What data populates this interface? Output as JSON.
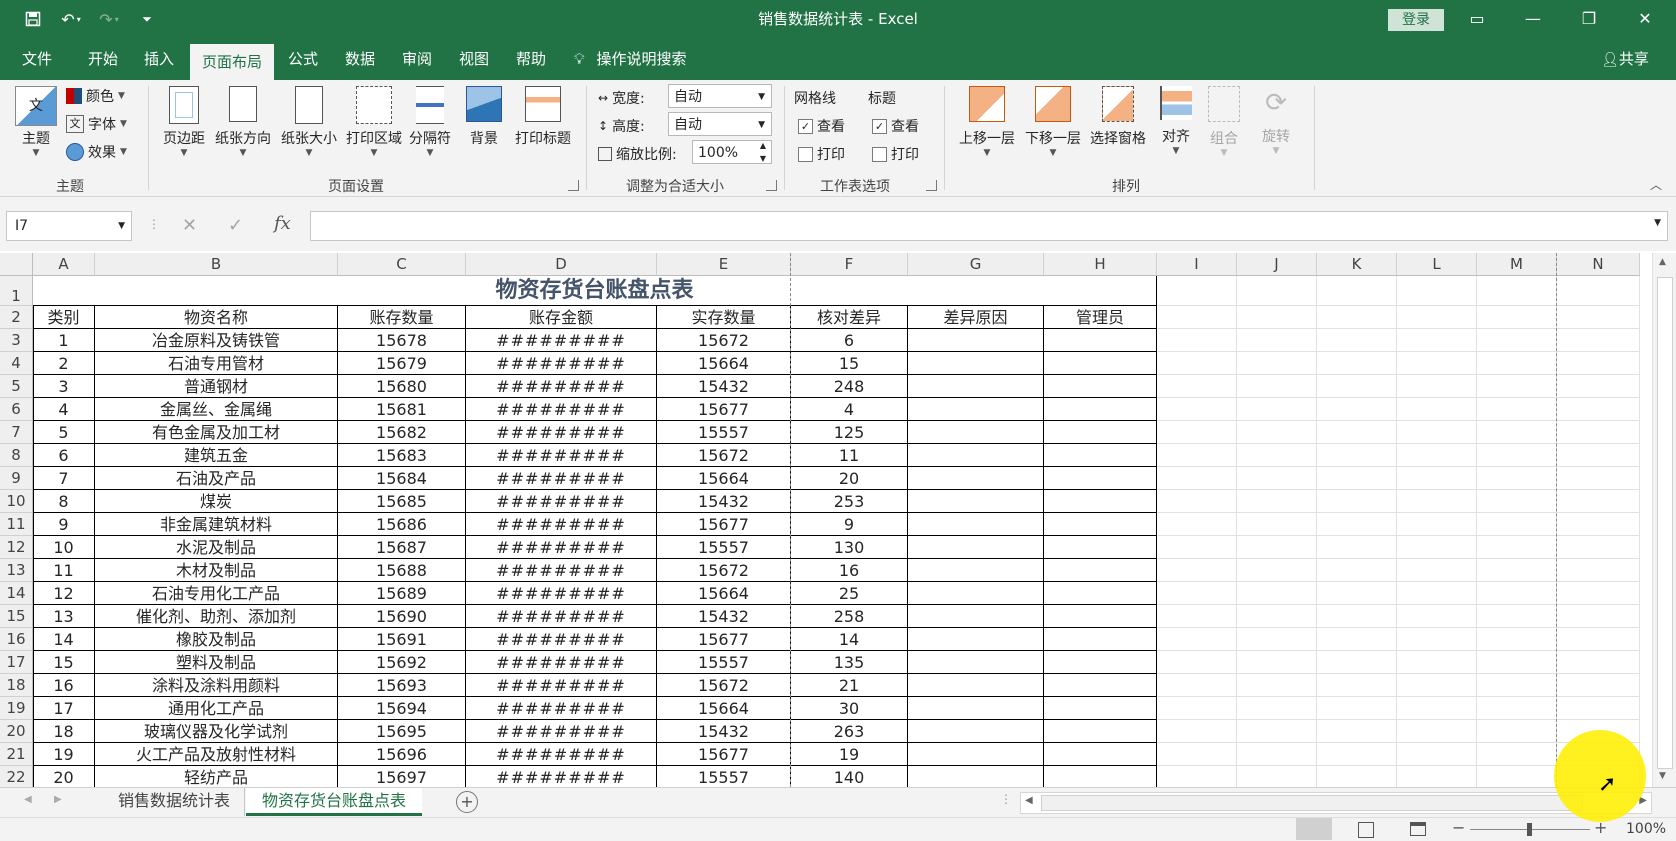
{
  "window": {
    "title": "销售数据统计表 - Excel",
    "login_label": "登录",
    "share_label": "共享"
  },
  "ribbon_tabs": [
    "文件",
    "开始",
    "插入",
    "页面布局",
    "公式",
    "数据",
    "审阅",
    "视图",
    "帮助",
    "操作说明搜索"
  ],
  "ribbon": {
    "theme": {
      "theme_btn": "主题",
      "colors": "颜色",
      "fonts": "字体",
      "effects": "效果",
      "group_label": "主题"
    },
    "page_setup": {
      "margins": "页边距",
      "orientation": "纸张方向",
      "size": "纸张大小",
      "print_area": "打印区域",
      "breaks": "分隔符",
      "background": "背景",
      "print_titles": "打印标题",
      "group_label": "页面设置"
    },
    "scale_to_fit": {
      "width_label": "宽度:",
      "width_value": "自动",
      "height_label": "高度:",
      "height_value": "自动",
      "scale_label": "缩放比例:",
      "scale_value": "100%",
      "group_label": "调整为合适大小"
    },
    "sheet_options": {
      "gridlines": "网格线",
      "headings": "标题",
      "view": "查看",
      "print": "打印",
      "group_label": "工作表选项"
    },
    "arrange": {
      "bring_forward": "上移一层",
      "send_backward": "下移一层",
      "selection_pane": "选择窗格",
      "align": "对齐",
      "group": "组合",
      "rotate": "旋转",
      "group_label": "排列"
    }
  },
  "formula_bar": {
    "name_box": "I7",
    "fx": "fx",
    "formula": ""
  },
  "columns": [
    "A",
    "B",
    "C",
    "D",
    "E",
    "F",
    "G",
    "H",
    "I",
    "J",
    "K",
    "L",
    "M",
    "N"
  ],
  "rows": [
    "1",
    "2",
    "3",
    "4",
    "5",
    "6",
    "7",
    "8",
    "9",
    "10",
    "11",
    "12",
    "13",
    "14",
    "15",
    "16",
    "17",
    "18",
    "19",
    "20",
    "21",
    "22"
  ],
  "sheet": {
    "title": "物资存货台账盘点表",
    "headers": [
      "类别",
      "物资名称",
      "账存数量",
      "账存金额",
      "实存数量",
      "核对差异",
      "差异原因",
      "管理员"
    ],
    "data_rows": [
      [
        "1",
        "冶金原料及铸铁管",
        "15678",
        "#########",
        "15672",
        "6"
      ],
      [
        "2",
        "石油专用管材",
        "15679",
        "#########",
        "15664",
        "15"
      ],
      [
        "3",
        "普通钢材",
        "15680",
        "#########",
        "15432",
        "248"
      ],
      [
        "4",
        "金属丝、金属绳",
        "15681",
        "#########",
        "15677",
        "4"
      ],
      [
        "5",
        "有色金属及加工材",
        "15682",
        "#########",
        "15557",
        "125"
      ],
      [
        "6",
        "建筑五金",
        "15683",
        "#########",
        "15672",
        "11"
      ],
      [
        "7",
        "石油及产品",
        "15684",
        "#########",
        "15664",
        "20"
      ],
      [
        "8",
        "煤炭",
        "15685",
        "#########",
        "15432",
        "253"
      ],
      [
        "9",
        "非金属建筑材料",
        "15686",
        "#########",
        "15677",
        "9"
      ],
      [
        "10",
        "水泥及制品",
        "15687",
        "#########",
        "15557",
        "130"
      ],
      [
        "11",
        "木材及制品",
        "15688",
        "#########",
        "15672",
        "16"
      ],
      [
        "12",
        "石油专用化工产品",
        "15689",
        "#########",
        "15664",
        "25"
      ],
      [
        "13",
        "催化剂、助剂、添加剂",
        "15690",
        "#########",
        "15432",
        "258"
      ],
      [
        "14",
        "橡胶及制品",
        "15691",
        "#########",
        "15677",
        "14"
      ],
      [
        "15",
        "塑料及制品",
        "15692",
        "#########",
        "15557",
        "135"
      ],
      [
        "16",
        "涂料及涂料用颜料",
        "15693",
        "#########",
        "15672",
        "21"
      ],
      [
        "17",
        "通用化工产品",
        "15694",
        "#########",
        "15664",
        "30"
      ],
      [
        "18",
        "玻璃仪器及化学试剂",
        "15695",
        "#########",
        "15432",
        "263"
      ],
      [
        "19",
        "火工产品及放射性材料",
        "15696",
        "#########",
        "15677",
        "19"
      ],
      [
        "20",
        "轻纺产品",
        "15697",
        "#########",
        "15557",
        "140"
      ]
    ]
  },
  "sheet_tabs": [
    {
      "label": "销售数据统计表",
      "active": false
    },
    {
      "label": "物资存货台账盘点表",
      "active": true
    }
  ],
  "status": {
    "zoom": "100%"
  },
  "colors": {
    "brand": "#217346",
    "title_text": "#44546a",
    "cursor_highlight": "#ffef00"
  }
}
